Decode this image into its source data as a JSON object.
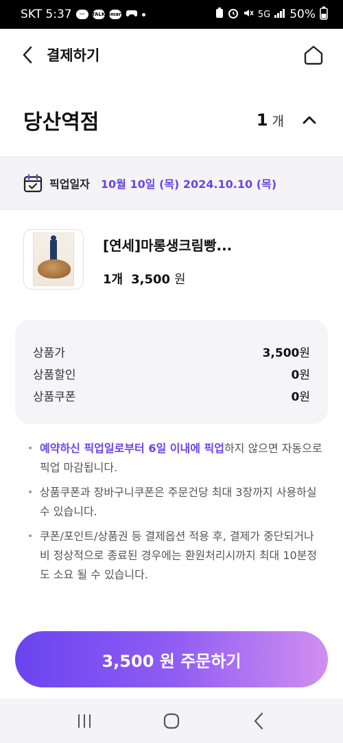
{
  "status_bar": {
    "carrier_time": "SKT 5:37",
    "talk_icon_label": "TALK",
    "kt_icon_label": "Bmart",
    "network": "5G",
    "battery": "50%"
  },
  "header": {
    "title": "결제하기"
  },
  "store": {
    "name": "당산역점",
    "quantity": "1",
    "quantity_unit": "개"
  },
  "pickup": {
    "label": "픽업일자",
    "date": "10월 10일 (목) 2024.10.10 (목)"
  },
  "product": {
    "name": "[연세]마롱생크림빵...",
    "quantity": "1개",
    "price": "3,500",
    "currency": "원"
  },
  "summary": {
    "rows": [
      {
        "label": "상품가",
        "value": "3,500",
        "unit": "원"
      },
      {
        "label": "상품할인",
        "value": "0",
        "unit": "원"
      },
      {
        "label": "상품쿠폰",
        "value": "0",
        "unit": "원"
      }
    ]
  },
  "notes": {
    "note1_highlight": "예약하신 픽업일로부터 6일 이내에 픽업",
    "note1_rest": "하지 않으면 자동으로 픽업 마감됩니다.",
    "note2": "상품쿠폰과 장바구니쿠폰은 주문건당 최대 3장까지 사용하실 수 있습니다.",
    "note3": "쿠폰/포인트/상품권 등 결제옵션 적용 후, 결제가 중단되거나 비 정상적으로 종료된 경우에는 환원처리시까지 최대 10분정도 소요 될 수 있습니다."
  },
  "order_button": {
    "label": "3,500 원 주문하기"
  },
  "colors": {
    "accent": "#6b44e6",
    "button_gradient_start": "#6a44f0",
    "button_gradient_end": "#d08ff0",
    "panel_bg": "#f5f5f7"
  }
}
